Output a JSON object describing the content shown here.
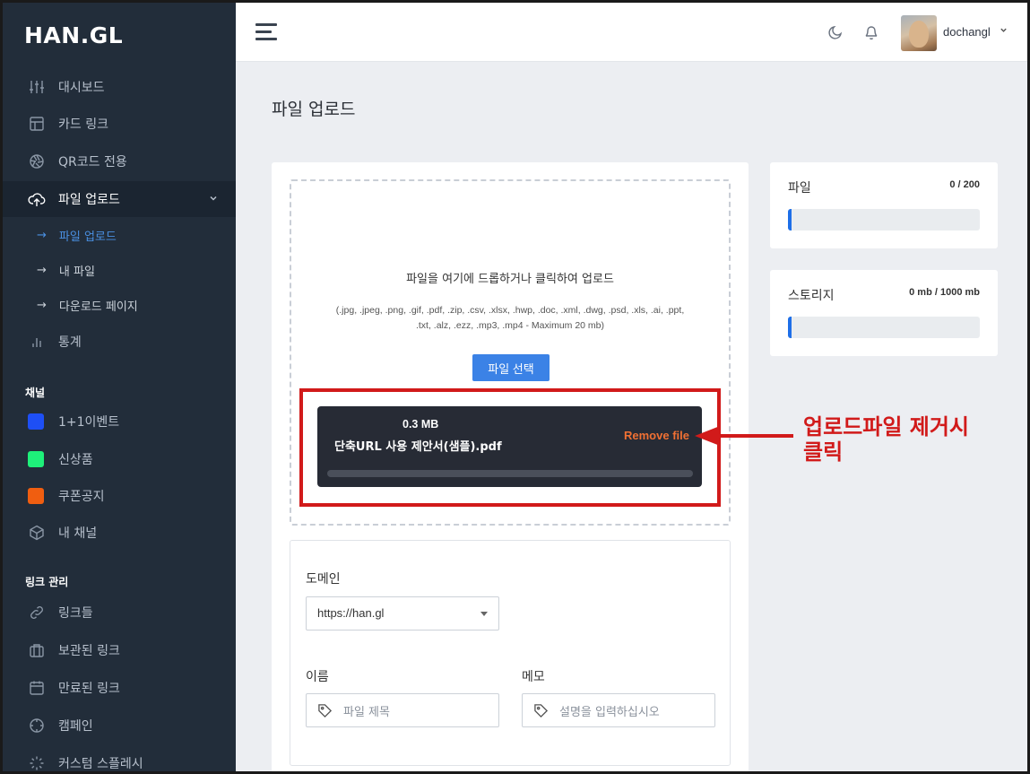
{
  "sidebar": {
    "logo": "HAN.GL",
    "items": [
      {
        "label": "대시보드",
        "icon": "sliders-icon"
      },
      {
        "label": "카드 링크",
        "icon": "layout-icon"
      },
      {
        "label": "QR코드 전용",
        "icon": "aperture-icon"
      },
      {
        "label": "파일 업로드",
        "icon": "upload-cloud-icon"
      }
    ],
    "sub_items": [
      {
        "label": "파일 업로드",
        "arrow": "→"
      },
      {
        "label": "내 파일",
        "arrow": "→"
      },
      {
        "label": "다운로드 페이지",
        "arrow": "→"
      }
    ],
    "stats_label": "통계",
    "channels_title": "채널",
    "channels": [
      {
        "label": "1+1이벤트",
        "color": "#1e4ff5"
      },
      {
        "label": "신상품",
        "color": "#1ef07a"
      },
      {
        "label": "쿠폰공지",
        "color": "#f05e10"
      }
    ],
    "my_channel_label": "내 채널",
    "links_title": "링크 관리",
    "link_items": [
      {
        "label": "링크들",
        "icon": "link-icon"
      },
      {
        "label": "보관된 링크",
        "icon": "briefcase-icon"
      },
      {
        "label": "만료된 링크",
        "icon": "calendar-icon"
      },
      {
        "label": "캠페인",
        "icon": "crosshair-icon"
      },
      {
        "label": "커스텀 스플레시",
        "icon": "loader-icon"
      }
    ]
  },
  "header": {
    "username": "dochangl"
  },
  "page": {
    "title": "파일 업로드"
  },
  "upload": {
    "message": "파일을 여기에 드롭하거나 클릭하여 업로드",
    "types_line1": "(.jpg, .jpeg, .png, .gif, .pdf, .zip, .csv, .xlsx, .hwp, .doc, .xml, .dwg, .psd, .xls, .ai, .ppt,",
    "types_line2": ".txt, .alz, .ezz, .mp3, .mp4 - Maximum 20 mb)",
    "choose_button": "파일 선택",
    "file": {
      "size": "0.3 MB",
      "name": "단축URL 사용 제안서(샘플).pdf",
      "remove_label": "Remove file"
    }
  },
  "form": {
    "domain_label": "도메인",
    "domain_value": "https://han.gl",
    "name_label": "이름",
    "name_placeholder": "파일 제목",
    "memo_label": "메모",
    "memo_placeholder": "설명을 입력하십시오"
  },
  "stats": {
    "files": {
      "label": "파일",
      "value": "0 / 200",
      "fill_fraction": 0
    },
    "storage": {
      "label": "스토리지",
      "value": "0 mb / 1000 mb",
      "fill_fraction": 0
    }
  },
  "annotation": {
    "line1": "업로드파일 제거시",
    "line2": "클릭",
    "color": "#d11a1a"
  }
}
